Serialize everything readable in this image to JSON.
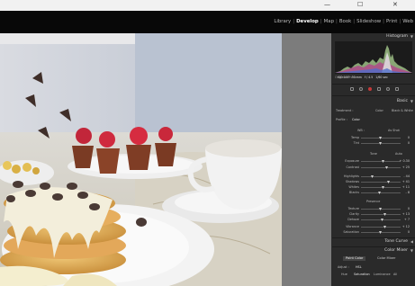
{
  "window": {
    "controls": {
      "minimize": "—",
      "maximize": "☐",
      "close": "✕"
    }
  },
  "modules": [
    {
      "label": "Library",
      "active": false
    },
    {
      "label": "Develop",
      "active": true
    },
    {
      "label": "Map",
      "active": false
    },
    {
      "label": "Book",
      "active": false
    },
    {
      "label": "Slideshow",
      "active": false
    },
    {
      "label": "Print",
      "active": false
    },
    {
      "label": "Web",
      "active": false
    }
  ],
  "module_separator": "|",
  "right_panel": {
    "histogram_label": "Histogram",
    "meta": [
      "ISO 100",
      "50 mm",
      "f / 4.5",
      "1/60 sec"
    ],
    "original_photo": "Original Photo",
    "basic_label": "Basic",
    "treatment_label": "Treatment :",
    "treatment_options": [
      "Color",
      "Black & White"
    ],
    "profile_label": "Profile :",
    "profile_value": "Color",
    "wb_label": "WB :",
    "wb_value": "As Shot",
    "temp": {
      "label": "Temp",
      "value": "0"
    },
    "tint": {
      "label": "Tint",
      "value": "0"
    },
    "tone_label": "Tone",
    "tone_auto": "Auto",
    "exposure": {
      "label": "Exposure",
      "value": "+ 0.30"
    },
    "contrast": {
      "label": "Contrast",
      "value": "+ 25"
    },
    "highlights": {
      "label": "Highlights",
      "value": "- 44"
    },
    "shadows": {
      "label": "Shadows",
      "value": "+ 41"
    },
    "whites": {
      "label": "Whites",
      "value": "+ 11"
    },
    "blacks": {
      "label": "Blacks",
      "value": "- 8"
    },
    "presence_label": "Presence",
    "texture": {
      "label": "Texture",
      "value": "0"
    },
    "clarity": {
      "label": "Clarity",
      "value": "+ 13"
    },
    "dehaze": {
      "label": "Dehaze",
      "value": "+ 7"
    },
    "vibrance": {
      "label": "Vibrance",
      "value": "+ 12"
    },
    "saturation": {
      "label": "Saturation",
      "value": "0"
    },
    "tone_curve_label": "Tone Curve",
    "color_mixer_label": "Color Mixer",
    "mixer_tabs": [
      "Point Color",
      "Color Mixer"
    ],
    "mixer_mode_label": "Adjust :",
    "mixer_mode": "HSL",
    "mixer_sub": [
      "Hue",
      "Saturation",
      "Luminance",
      "All"
    ]
  }
}
